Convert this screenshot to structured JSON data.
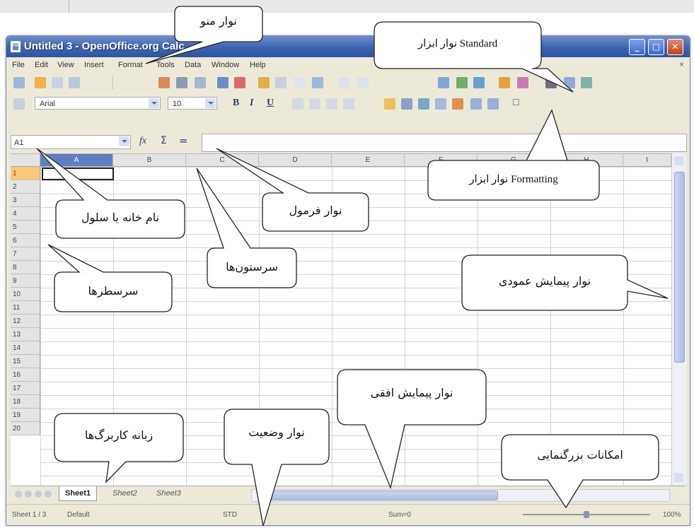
{
  "window": {
    "title": "Untitled 3 - OpenOffice.org Calc",
    "minimize_glyph": "_",
    "maximize_glyph": "□",
    "close_glyph": "✕"
  },
  "menubar": {
    "items": [
      "File",
      "Edit",
      "View",
      "Insert",
      "Format",
      "Tools",
      "Data",
      "Window",
      "Help"
    ],
    "close_glyph": "×"
  },
  "formatting": {
    "font_name": "Arial",
    "font_size": "10",
    "bold": "B",
    "italic": "I",
    "underline": "U",
    "border_glyph": "□"
  },
  "formula_bar": {
    "name_box": "A1",
    "fx": "fx",
    "sum": "Σ",
    "equals": "="
  },
  "grid": {
    "columns": [
      "A",
      "B",
      "C",
      "D",
      "E",
      "F",
      "G",
      "H",
      "I"
    ],
    "rows": [
      "1",
      "2",
      "3",
      "4",
      "5",
      "6",
      "7",
      "8",
      "9",
      "10",
      "11",
      "12",
      "13",
      "14",
      "15",
      "16",
      "17",
      "18",
      "19",
      "20"
    ]
  },
  "sheet_tabs": {
    "tabs": [
      "Sheet1",
      "Sheet2",
      "Sheet3"
    ],
    "active": "Sheet1"
  },
  "statusbar": {
    "sheet": "Sheet 1 / 3",
    "style": "Default",
    "mode": "STD",
    "sum": "Sum=0",
    "zoom": "100%",
    "zoom_level": 0.5
  },
  "callouts": {
    "menu_bar": "نوار منو",
    "standard_toolbar": "نوار ابزار Standard",
    "formatting_toolbar": "نوار ابزار Formatting",
    "cell_name": "نام خانه یا سلول",
    "formula_bar": "نوار فرمول",
    "column_headers": "سرستون‌ها",
    "row_headers": "سرسطرها",
    "vertical_scrollbar": "نوار پیمایش عمودی",
    "horizontal_scrollbar": "نوار پیمایش افقی",
    "sheet_tabs": "زبانه کاربرگ‌ها",
    "status_bar": "نوار وضعیت",
    "zoom": "امکانات بزرگنمایی"
  }
}
